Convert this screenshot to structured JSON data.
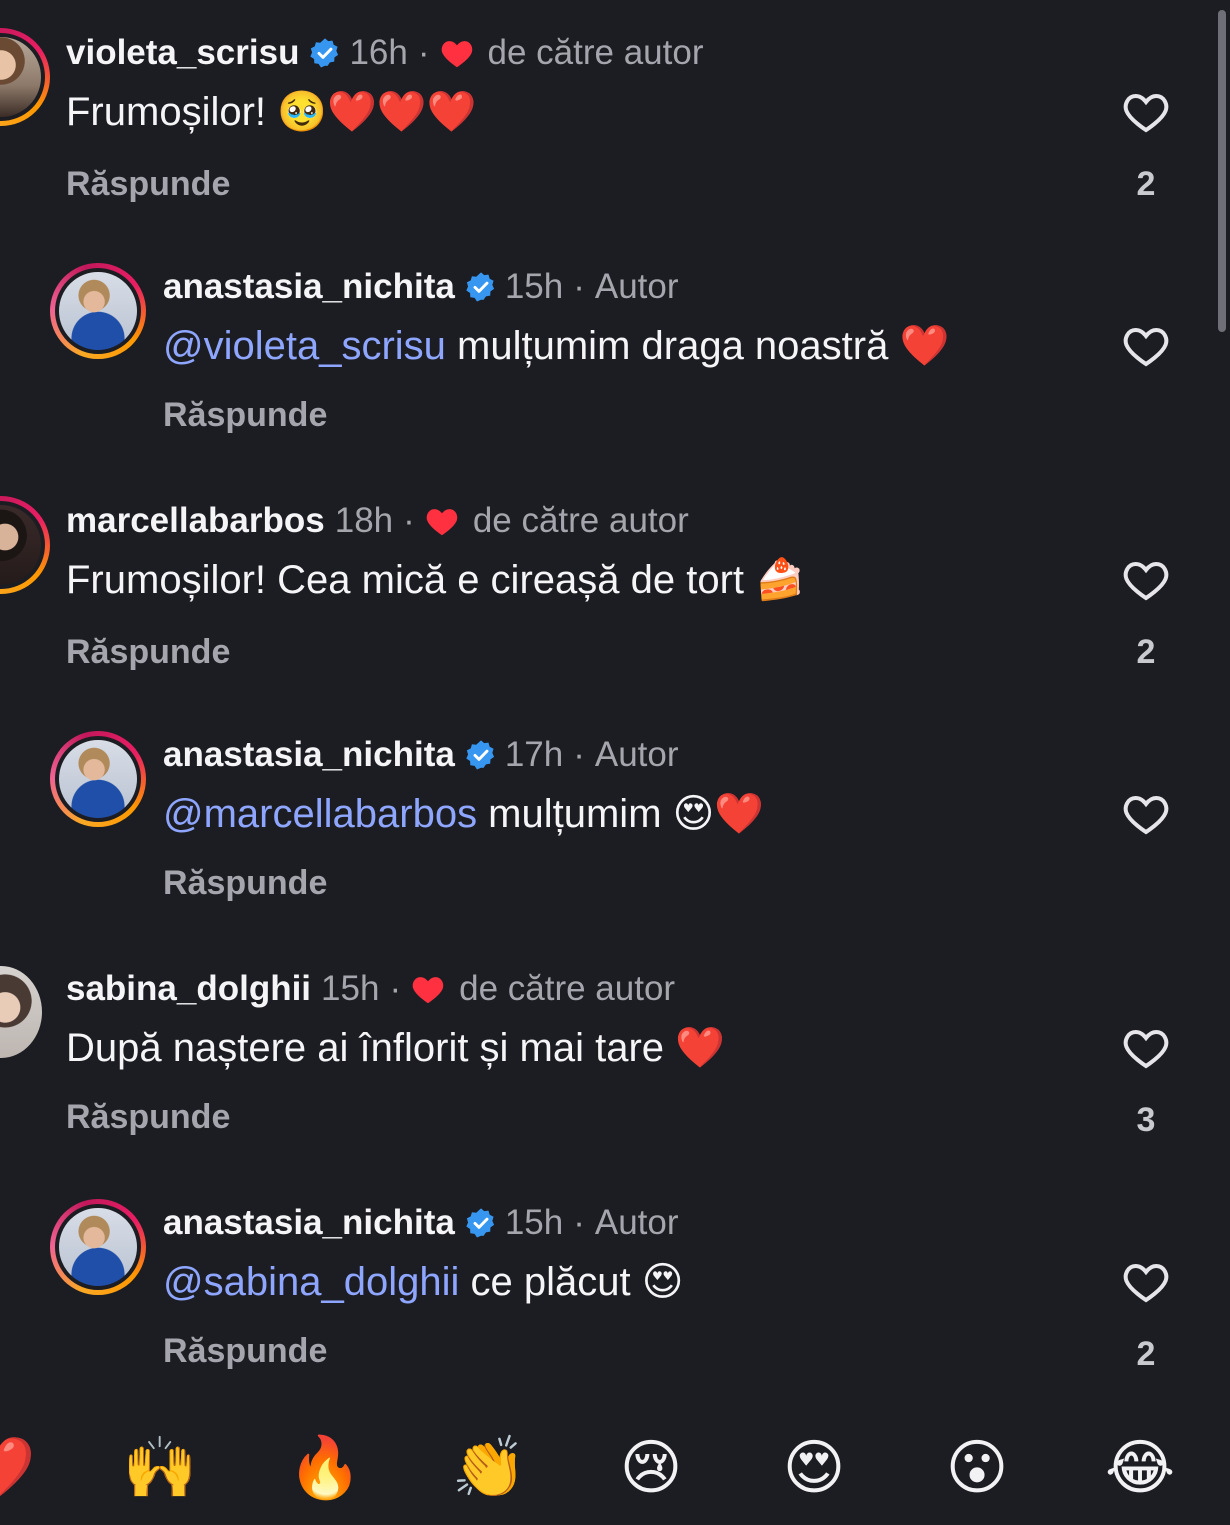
{
  "comments": [
    {
      "username": "violeta_scrisu",
      "verified": true,
      "time": "16h",
      "meta_label": "de către autor",
      "text": "Frumoșilor! 🥹❤️❤️❤️",
      "reply_label": "Răspunde",
      "likes": "2"
    },
    {
      "username": "anastasia_nichita",
      "verified": true,
      "time": "15h",
      "meta_label": "Autor",
      "mention": "@violeta_scrisu",
      "text": " mulțumim draga noastră ❤️",
      "reply_label": "Răspunde"
    },
    {
      "username": "marcellabarbos",
      "verified": false,
      "time": "18h",
      "meta_label": "de către autor",
      "text": "Frumoșilor! Cea mică e cireașă de tort 🍰",
      "reply_label": "Răspunde",
      "likes": "2"
    },
    {
      "username": "anastasia_nichita",
      "verified": true,
      "time": "17h",
      "meta_label": "Autor",
      "mention": "@marcellabarbos",
      "text": " mulțumim 😍❤️",
      "reply_label": "Răspunde"
    },
    {
      "username": "sabina_dolghii",
      "verified": false,
      "time": "15h",
      "meta_label": "de către autor",
      "text": "După naștere ai înflorit și mai tare ❤️",
      "reply_label": "Răspunde",
      "likes": "3"
    },
    {
      "username": "anastasia_nichita",
      "verified": true,
      "time": "15h",
      "meta_label": "Autor",
      "mention": "@sabina_dolghii",
      "text": " ce plăcut 😍",
      "reply_label": "Răspunde",
      "likes": "2"
    }
  ],
  "separator": "·",
  "reactions": [
    "❤️",
    "🙌",
    "🔥",
    "👏",
    "😢",
    "😍",
    "😮",
    "😂"
  ],
  "icons": {
    "verified": "verified-badge-icon",
    "like": "heart-outline-icon",
    "liked_by_author": "heart-filled-icon"
  },
  "colors": {
    "background": "#1c1d22",
    "mention": "#8ea6ff",
    "verified": "#3797f0",
    "heart": "#ff3040"
  }
}
